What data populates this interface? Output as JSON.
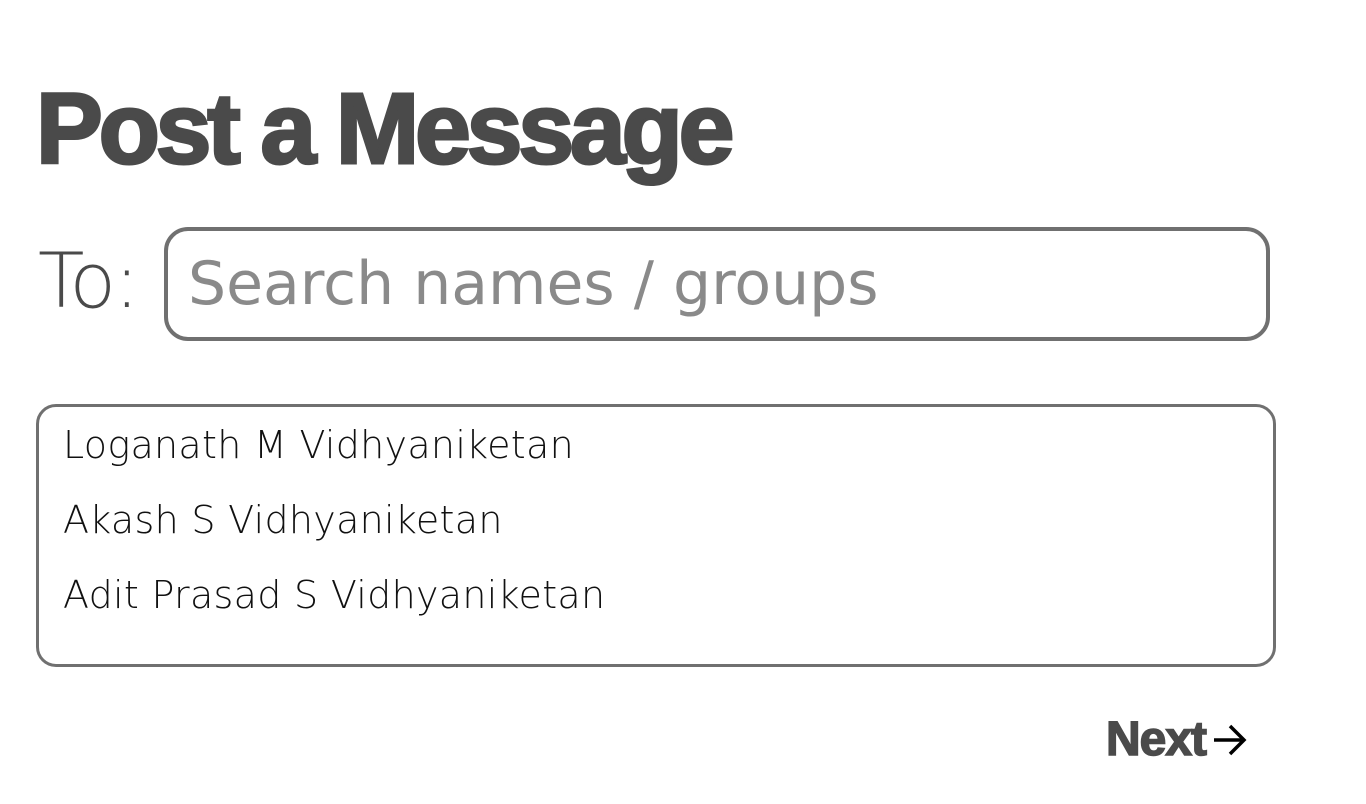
{
  "header": {
    "title": "Post a Message"
  },
  "recipient": {
    "label": "To:",
    "placeholder": "Search names / groups",
    "value": ""
  },
  "suggestions": [
    {
      "label": "Loganath M Vidhyaniketan"
    },
    {
      "label": "Akash S Vidhyaniketan"
    },
    {
      "label": "Adit Prasad S Vidhyaniketan"
    }
  ],
  "footer": {
    "next_label": "Next",
    "next_icon": "arrow-right-icon"
  }
}
